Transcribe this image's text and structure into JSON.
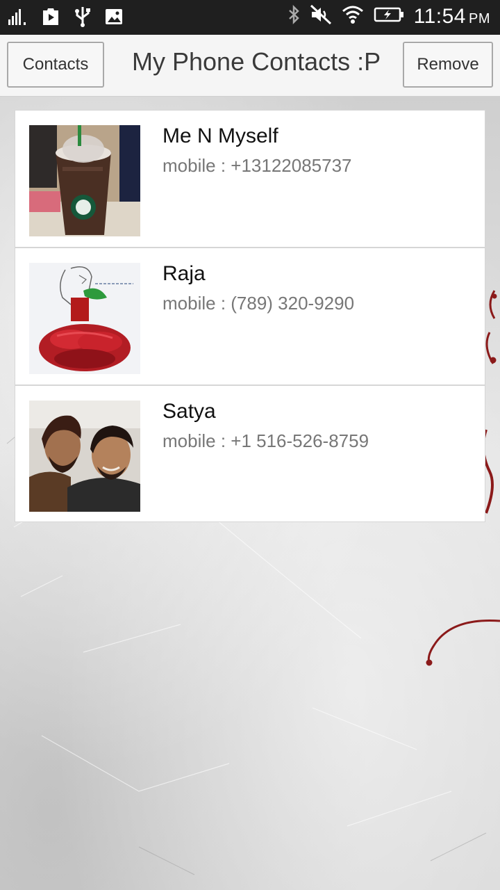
{
  "status_bar": {
    "time": "11:54",
    "ampm": "PM",
    "icons": [
      "signal-icon",
      "play-store-icon",
      "usb-icon",
      "image-icon",
      "bluetooth-icon",
      "mute-icon",
      "wifi-icon",
      "battery-charging-icon"
    ]
  },
  "action_bar": {
    "left_button": "Contacts",
    "title": "My Phone Contacts :P",
    "right_button": "Remove"
  },
  "contacts": [
    {
      "name": "Me N Myself",
      "phone": "mobile : +13122085737",
      "photo": "starbucks-drink-photo"
    },
    {
      "name": "Raja",
      "phone": "mobile : (789) 320-9290",
      "photo": "rose-drawing-photo"
    },
    {
      "name": "Satya",
      "phone": "mobile : +1 516-526-8759",
      "photo": "two-men-selfie-photo"
    }
  ]
}
